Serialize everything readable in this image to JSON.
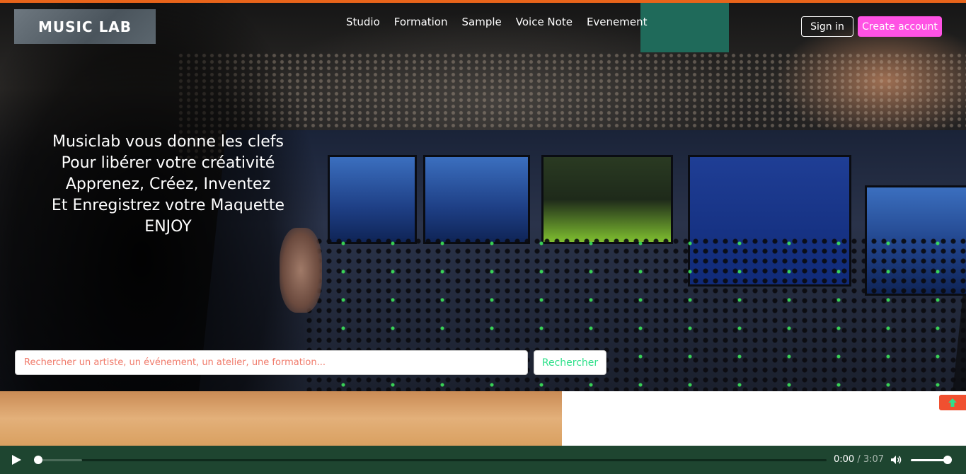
{
  "brand": {
    "logo_text": "MUSIC LAB"
  },
  "nav": {
    "items": [
      {
        "label": "Studio"
      },
      {
        "label": "Formation"
      },
      {
        "label": "Sample"
      },
      {
        "label": "Voice Note"
      },
      {
        "label": "Evenement"
      }
    ]
  },
  "auth": {
    "signin_label": "Sign in",
    "create_label": "Create account"
  },
  "hero": {
    "lines": [
      "Musiclab vous donne les clefs",
      "Pour libérer votre créativité",
      "Apprenez, Créez, Inventez",
      "Et Enregistrez votre Maquette",
      "ENJOY"
    ]
  },
  "search": {
    "placeholder": "Rechercher un artiste, un événement, un atelier, une formation...",
    "value": "",
    "button_label": "Rechercher"
  },
  "scroll_top": {
    "icon": "arrow-up-icon",
    "color": "#f05030",
    "icon_color": "#2ee08a"
  },
  "audio_player": {
    "current_time": "0:00",
    "separator": " / ",
    "duration": "3:07",
    "progress": 0.0,
    "volume": 1.0,
    "play_icon": "play-icon",
    "volume_icon": "volume-icon"
  },
  "colors": {
    "accent_top": "#e8641a",
    "create_button": "#ff52e4",
    "search_button_text": "#2ee08a",
    "placeholder_text": "#f07a6a",
    "audio_bar": "#1e4530"
  }
}
